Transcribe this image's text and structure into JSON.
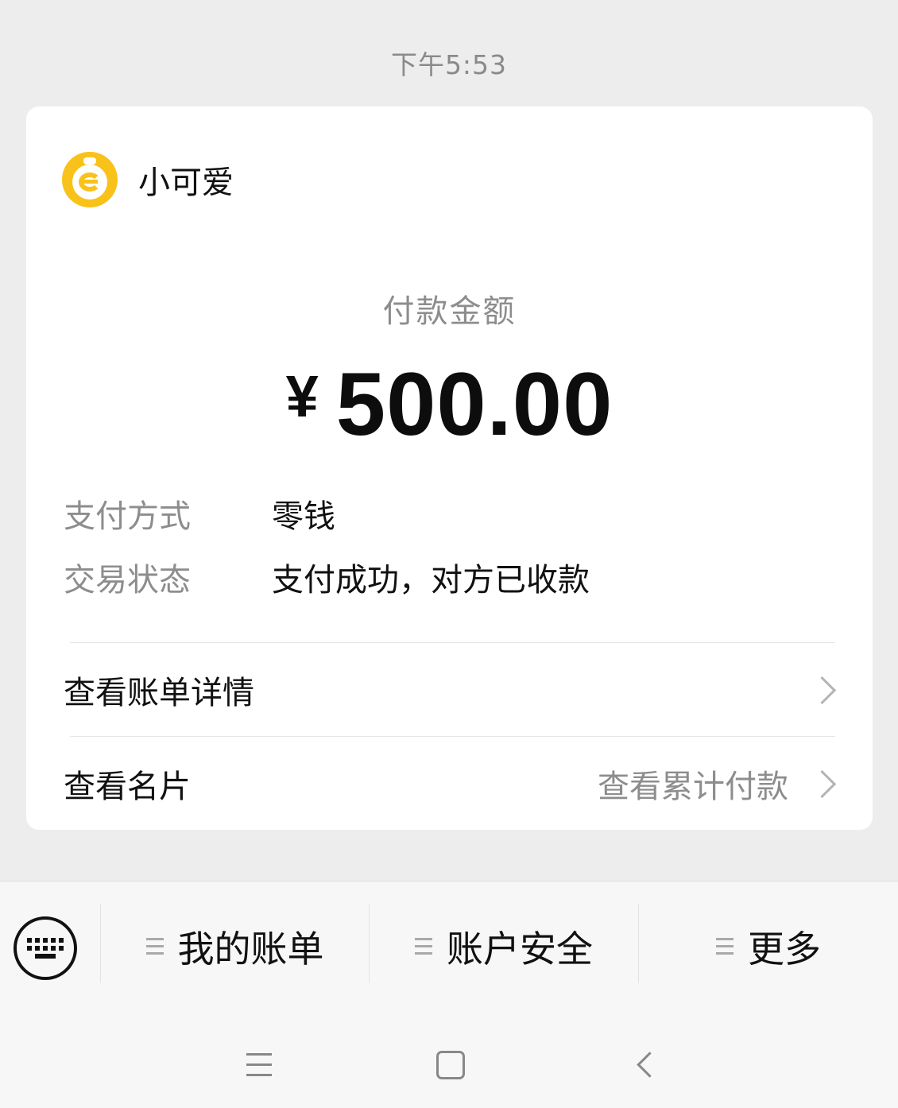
{
  "timestamp": "下午5:53",
  "payee": {
    "name": "小可爱",
    "avatar_icon": "yellow-money-bag-icon"
  },
  "amount": {
    "label": "付款金额",
    "currency": "¥",
    "value": "500.00"
  },
  "details": [
    {
      "key": "支付方式",
      "value": "零钱"
    },
    {
      "key": "交易状态",
      "value": "支付成功，对方已收款"
    }
  ],
  "links": {
    "bill_detail": "查看账单详情",
    "profile_card": "查看名片",
    "cumulative": "查看累计付款"
  },
  "menu": {
    "items": [
      "我的账单",
      "账户安全",
      "更多"
    ]
  },
  "colors": {
    "accent": "#f9c21a",
    "background": "#ededed"
  }
}
